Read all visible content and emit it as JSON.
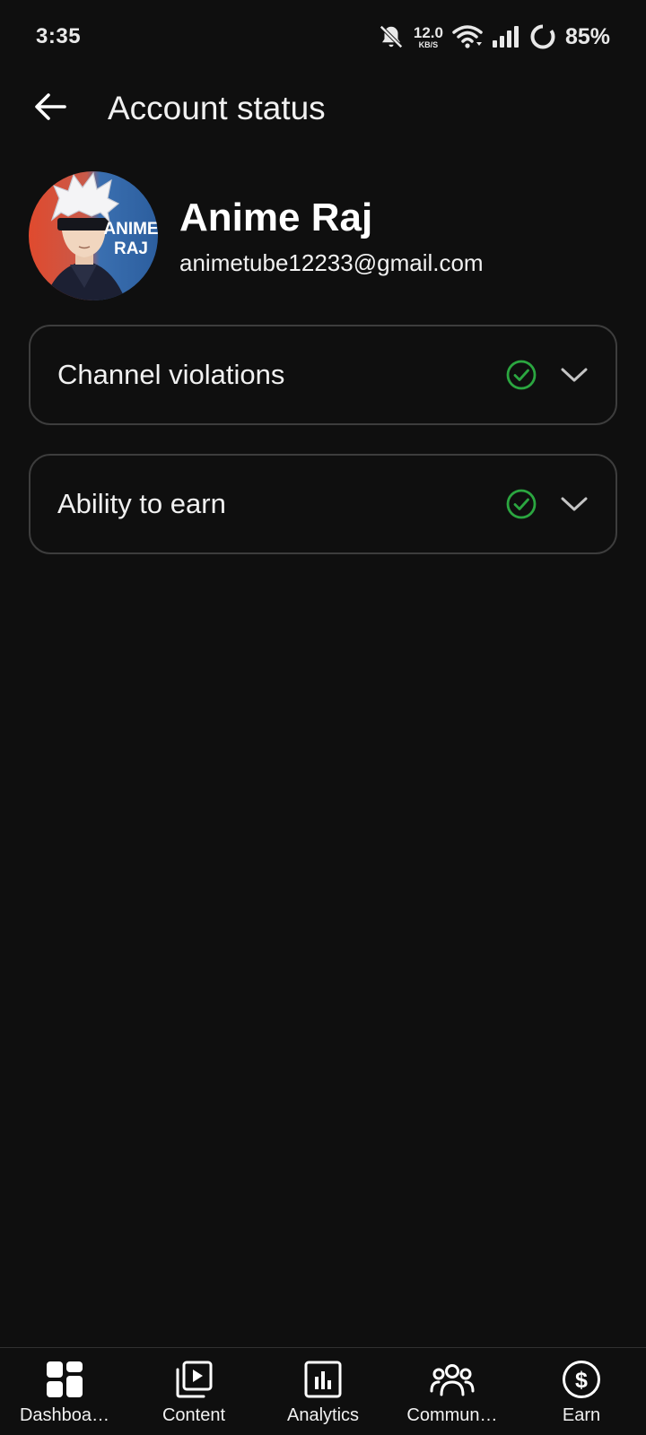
{
  "status_bar": {
    "time": "3:35",
    "net_speed_value": "12.0",
    "net_speed_unit": "KB/S",
    "battery": "85%",
    "icons": [
      "bell-off-icon",
      "wifi-icon",
      "signal-icon",
      "battery-ring-icon"
    ]
  },
  "header": {
    "title": "Account status",
    "back_icon": "arrow-left-icon"
  },
  "profile": {
    "name": "Anime Raj",
    "email": "animetube12233@gmail.com",
    "avatar_text_line1": "ANIME",
    "avatar_text_line2": "RAJ"
  },
  "cards": [
    {
      "label": "Channel violations",
      "status": "ok",
      "status_icon": "check-circle-icon",
      "expand_icon": "chevron-down-icon"
    },
    {
      "label": "Ability to earn",
      "status": "ok",
      "status_icon": "check-circle-icon",
      "expand_icon": "chevron-down-icon"
    }
  ],
  "bottom_nav": {
    "items": [
      {
        "label": "Dashboa…",
        "icon": "dashboard-icon"
      },
      {
        "label": "Content",
        "icon": "content-icon"
      },
      {
        "label": "Analytics",
        "icon": "analytics-icon"
      },
      {
        "label": "Commun…",
        "icon": "community-icon"
      },
      {
        "label": "Earn",
        "icon": "earn-icon"
      }
    ]
  },
  "colors": {
    "background": "#0f0f0f",
    "card_border": "#3d3d3d",
    "check_green": "#2ba640",
    "text": "#f1f1f1"
  }
}
